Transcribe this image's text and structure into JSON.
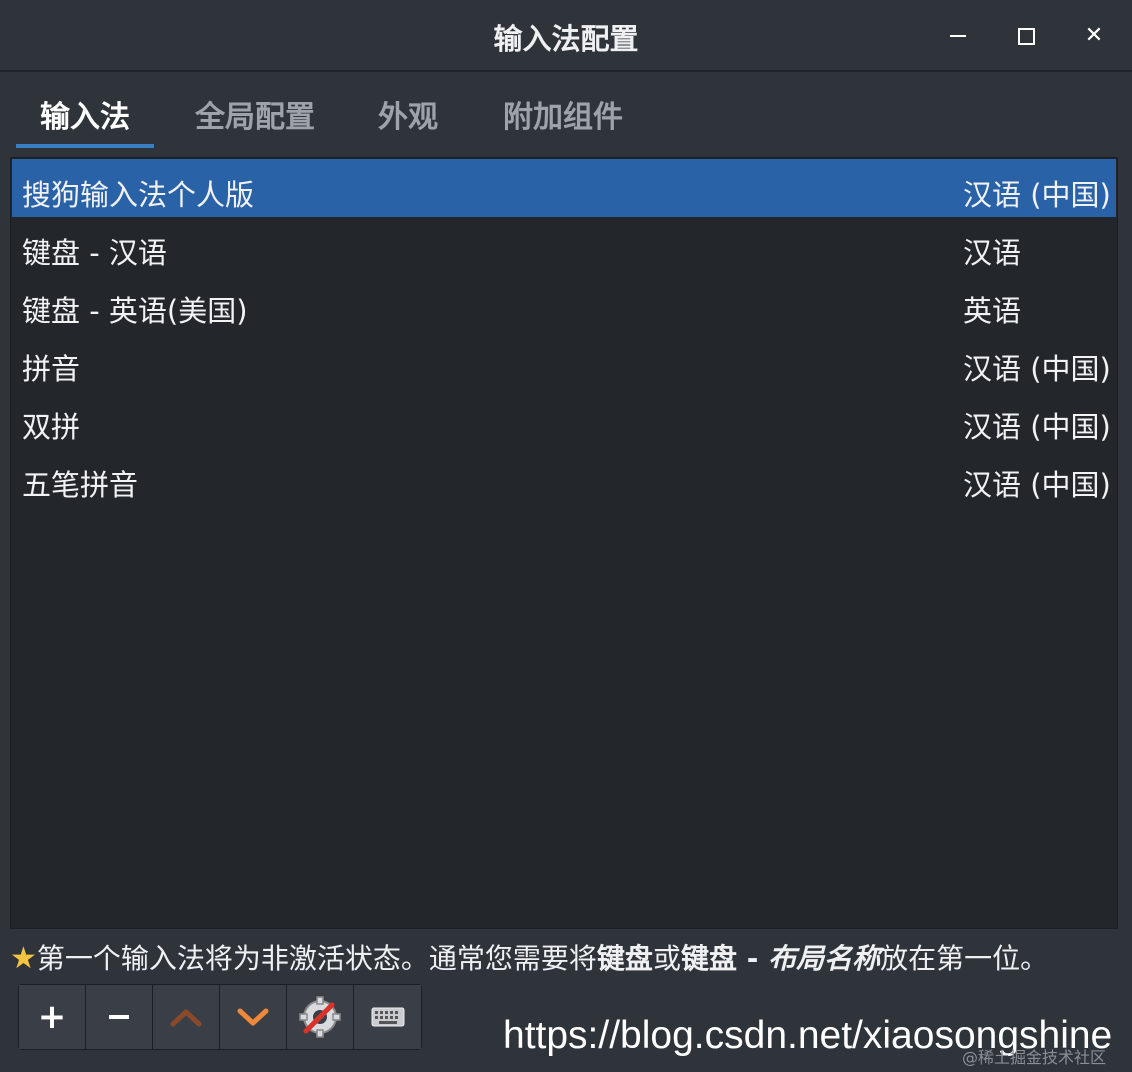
{
  "window": {
    "title": "输入法配置",
    "controls": [
      "minimize",
      "maximize",
      "close"
    ]
  },
  "tabs": [
    {
      "label": "输入法",
      "active": true
    },
    {
      "label": "全局配置",
      "active": false
    },
    {
      "label": "外观",
      "active": false
    },
    {
      "label": "附加组件",
      "active": false
    }
  ],
  "input_methods": [
    {
      "name": "搜狗输入法个人版",
      "language": "汉语 (中国)",
      "selected": true
    },
    {
      "name": "键盘 - 汉语",
      "language": "汉语",
      "selected": false
    },
    {
      "name": "键盘 - 英语(美国)",
      "language": "英语",
      "selected": false
    },
    {
      "name": "拼音",
      "language": "汉语 (中国)",
      "selected": false
    },
    {
      "name": "双拼",
      "language": "汉语 (中国)",
      "selected": false
    },
    {
      "name": "五笔拼音",
      "language": "汉语 (中国)",
      "selected": false
    }
  ],
  "hint": {
    "icon": "star-icon",
    "part1": "第一个输入法将为非激活状态。通常您需要将",
    "bold1": "键盘",
    "part2": "或",
    "bold2": "键盘 - ",
    "italic": "布局名称",
    "part3": "放在第一位。"
  },
  "toolbar": {
    "buttons": [
      {
        "name": "add",
        "icon": "plus-icon"
      },
      {
        "name": "remove",
        "icon": "minus-icon"
      },
      {
        "name": "move-up",
        "icon": "chevron-up-icon"
      },
      {
        "name": "move-down",
        "icon": "chevron-down-icon"
      },
      {
        "name": "configure",
        "icon": "settings-tools-icon"
      },
      {
        "name": "keyboard-layout",
        "icon": "keyboard-icon"
      }
    ]
  },
  "watermark": {
    "url": "https://blog.csdn.net/xiaosongshine",
    "sub": "@稀土掘金技术社区"
  },
  "colors": {
    "selection": "#2a62a8",
    "tab_indicator": "#3a7fc3",
    "background": "#2f343b",
    "list_background": "#23272c"
  }
}
